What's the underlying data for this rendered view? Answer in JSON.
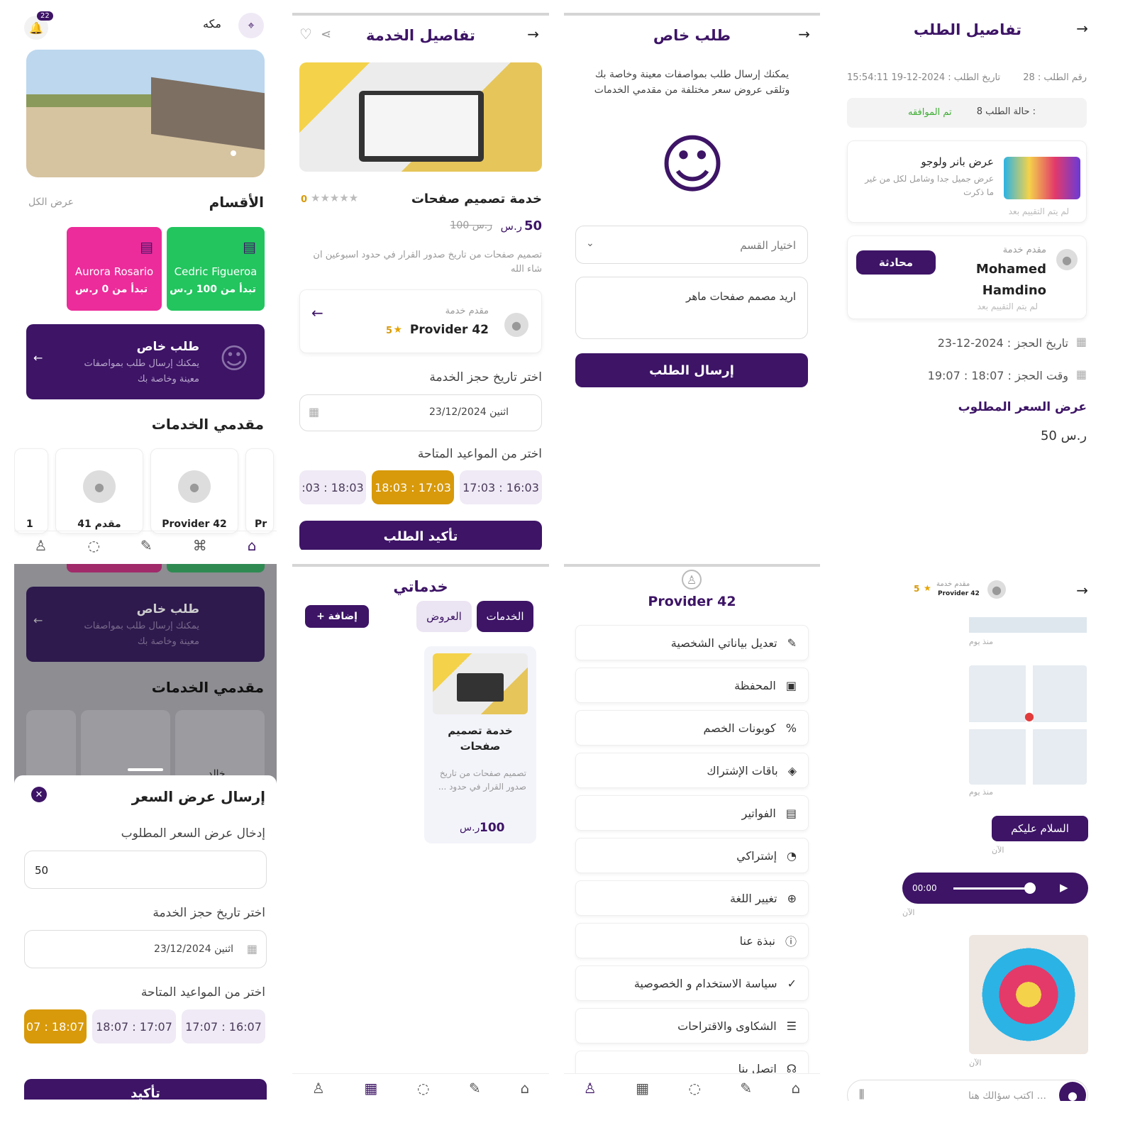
{
  "home": {
    "notif_count": "22",
    "city": "مكه",
    "sections_title": "الأقسام",
    "view_all": "عرض الكل",
    "cat1": {
      "name": "Cedric Figueroa",
      "price": "تبدأ من 100 ر.س"
    },
    "cat2": {
      "name": "Aurora Rosario",
      "price": "تبدأ من 0 ر.س"
    },
    "special_title": "طلب خاص",
    "special_desc1": "يمكنك إرسال طلب بمواصفات",
    "special_desc2": "معينة وخاصة بك",
    "providers_title": "مقدمي الخدمات",
    "prov1": "Provider 42",
    "prov2": "مقدم 41",
    "prov3": "Pr",
    "prov4": "1"
  },
  "service": {
    "title": "تفاصيل الخدمة",
    "name": "خدمة تصميم صفحات",
    "rating": "0",
    "price": "50",
    "currency": "ر.س",
    "old_price": "100 ر.س",
    "desc": "تصميم صفحات من تاريخ صدور القرار في حدود اسبوعين ان شاء الله",
    "provider_label": "مقدم خدمة",
    "provider_name": "Provider 42",
    "provider_rating": "5",
    "date_label": "اختر تاريخ حجز الخدمة",
    "date_value": "اثنين 23/12/2024",
    "slots_label": "اختر من المواعيد المتاحة",
    "slots": [
      "17:03 : 16:03",
      "18:03 : 17:03",
      ":03 : 18:03"
    ],
    "confirm": "تأكيد الطلب"
  },
  "special": {
    "title": "طلب خاص",
    "desc": "يمكنك إرسال طلب بمواصفات معينة وخاصة بك وتلقى عروض سعر مختلفة من مقدمي الخدمات",
    "category_placeholder": "اختيار القسم",
    "text_value": "اريد مصمم صفحات ماهر",
    "send": "إرسال الطلب"
  },
  "order": {
    "title": "تفاصيل الطلب",
    "order_no": "رقم الطلب : 28",
    "order_date": "تاريخ الطلب : 2024-12-19 15:54:11",
    "status_label": "8 حالة الطلب :",
    "status_value": "تم الموافقه",
    "item_title": "عرض بانر ولوجو",
    "item_desc": "عرض جميل جدا وشامل لكل من غير ما ذكرت",
    "not_rated": "لم يتم التقييم بعد",
    "provider_label": "مقدم خدمة",
    "provider_name1": "Mohamed",
    "provider_name2": "Hamdino",
    "chat": "محادثة",
    "booking_date": "تاريخ الحجز : 2024-12-23",
    "booking_time": "وقت الحجز : 18:07 : 19:07",
    "price_title": "عرض السعر المطلوب",
    "price_value": "50 ر.س"
  },
  "offer": {
    "special_title": "طلب خاص",
    "special_desc1": "يمكنك إرسال طلب بمواصفات",
    "special_desc2": "معينة وخاصة بك",
    "providers_title": "مقدمي الخدمات",
    "prov_partial": "خالد",
    "title": "إرسال عرض السعر",
    "price_label": "إدخال عرض السعر المطلوب",
    "price_value": "50",
    "date_label": "اختر تاريخ حجز الخدمة",
    "date_value": "اثنين 23/12/2024",
    "slots_label": "اختر من المواعيد المتاحة",
    "slots": [
      "17:07 : 16:07",
      "18:07 : 17:07",
      "07 : 18:07"
    ],
    "confirm": "تأكيد"
  },
  "myservices": {
    "title": "خدماتي",
    "tab_services": "الخدمات",
    "tab_offers": "العروض",
    "add": "+ إضافة",
    "card_title": "خدمة تصميم صفحات",
    "card_desc": "تصميم صفحات من تاريخ صدور القرار في حدود ...",
    "card_price": "100",
    "card_currency": "ر.س"
  },
  "profile": {
    "name": "Provider 42",
    "items": [
      "تعديل بياناتي الشخصية",
      "المحفظة",
      "كوبونات الخصم",
      "باقات الإشتراك",
      "الفواتير",
      "إشتراكي",
      "تغيير اللغة",
      "نبذة عنا",
      "سياسة الاستخدام و الخصوصية",
      "الشكاوى والاقتراحات",
      "اتصل بنا"
    ]
  },
  "chat": {
    "provider_label": "مقدم خدمة",
    "provider_name": "Provider 42",
    "rating": "5",
    "time1": "منذ يوم",
    "time2": "منذ يوم",
    "msg": "السلام عليكم",
    "now1": "الآن",
    "audio_time": "00:00",
    "now2": "الآن",
    "now3": "الآن",
    "input_placeholder": "اكتب سؤالك هنا ..."
  }
}
